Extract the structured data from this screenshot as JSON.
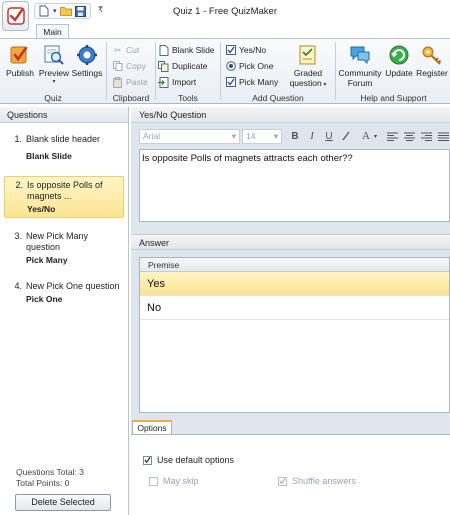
{
  "window": {
    "title": "Quiz 1 - Free QuizMaker"
  },
  "ribbon": {
    "tab_main": "Main",
    "groups": {
      "quiz": {
        "label": "Quiz",
        "publish": "Publish",
        "preview": "Preview",
        "settings": "Settings"
      },
      "clipboard": {
        "label": "Clipboard",
        "cut": "Cut",
        "copy": "Copy",
        "paste": "Paste"
      },
      "tools": {
        "label": "Tools",
        "blank_slide": "Blank Slide",
        "duplicate": "Duplicate",
        "import": "Import"
      },
      "add_question": {
        "label": "Add Question",
        "yes_no": "Yes/No",
        "pick_one": "Pick One",
        "pick_many": "Pick Many",
        "graded_line1": "Graded",
        "graded_line2": "question"
      },
      "help": {
        "label": "Help and Support",
        "community_line1": "Community",
        "community_line2": "Forum",
        "update": "Update",
        "register": "Register"
      }
    }
  },
  "questions_panel": {
    "header": "Questions",
    "items": [
      {
        "num": "1.",
        "title": "Blank slide header",
        "type": "Blank Slide"
      },
      {
        "num": "2.",
        "title": "Is opposite Polls of magnets ...",
        "type": "Yes/No"
      },
      {
        "num": "3.",
        "title": "New Pick Many question",
        "type": "Pick Many"
      },
      {
        "num": "4.",
        "title": "New Pick One question",
        "type": "Pick One"
      }
    ],
    "total_questions": "Questions Total: 3",
    "total_points": "Total Points: 0",
    "delete_button": "Delete Selected"
  },
  "question_editor": {
    "header": "Yes/No Question",
    "font": "Arial",
    "size": "14",
    "text": "Is opposite Polls of magnets attracts each other??"
  },
  "answer": {
    "header": "Answer",
    "column": "Premise",
    "rows": [
      "Yes",
      "No"
    ]
  },
  "options": {
    "tab": "Options",
    "use_default": "Use default options",
    "may_skip": "May skip",
    "shuffle": "Shuffle answers"
  },
  "colors": {
    "selected_bg": "#fbe493",
    "accent_orange": "#f0a93a",
    "header_bg": "#e3e8ee"
  }
}
